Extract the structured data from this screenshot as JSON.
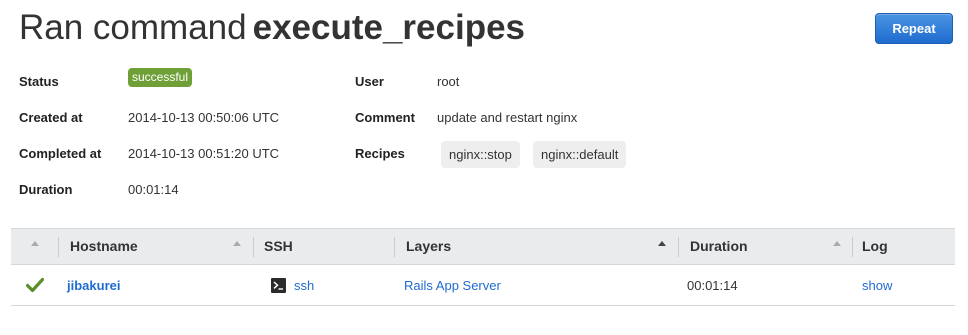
{
  "header": {
    "title_prefix": "Ran command",
    "command_name": "execute_recipes",
    "repeat_label": "Repeat"
  },
  "details": {
    "status_label": "Status",
    "status_value": "successful",
    "created_label": "Created at",
    "created_value": "2014-10-13 00:50:06 UTC",
    "completed_label": "Completed at",
    "completed_value": "2014-10-13 00:51:20 UTC",
    "duration_label": "Duration",
    "duration_value": "00:01:14",
    "user_label": "User",
    "user_value": "root",
    "comment_label": "Comment",
    "comment_value": "update and restart nginx",
    "recipes_label": "Recipes",
    "recipes": [
      "nginx::stop",
      "nginx::default"
    ]
  },
  "table": {
    "columns": [
      "Hostname",
      "SSH",
      "Layers",
      "Duration",
      "Log"
    ],
    "rows": [
      {
        "status_icon": "check-icon",
        "hostname": "jibakurei",
        "ssh": "ssh",
        "ssh_icon": "terminal-icon",
        "layers": "Rails App Server",
        "duration": "00:01:14",
        "log": "show"
      }
    ]
  },
  "colors": {
    "success_badge": "#6f9f37",
    "primary_button": "#1f6ccf",
    "link": "#1f6ccf",
    "check": "#5a8f2a"
  }
}
